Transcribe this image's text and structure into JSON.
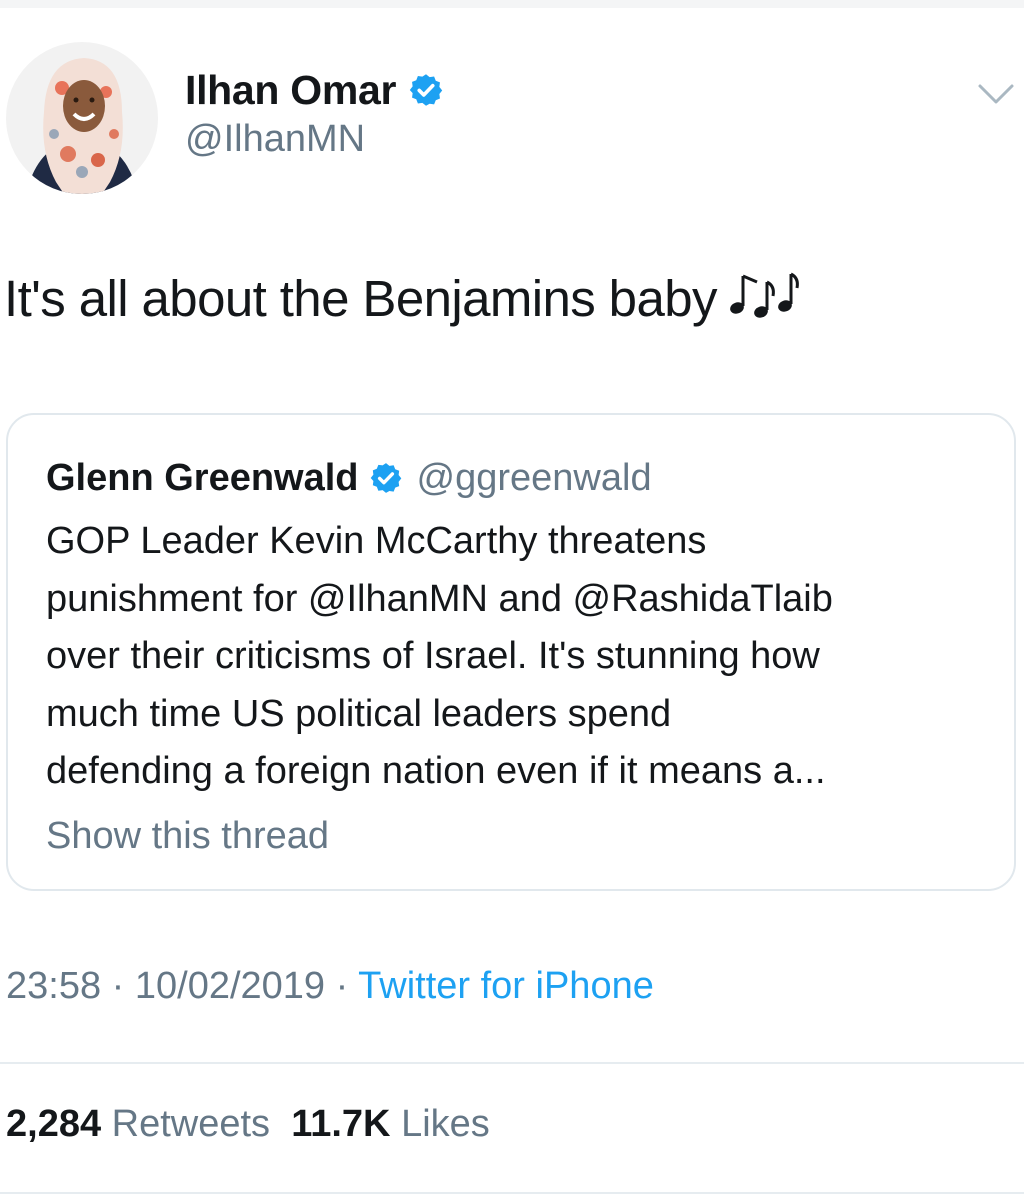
{
  "tweet": {
    "author": {
      "name": "Ilhan Omar",
      "handle": "@IlhanMN",
      "avatar_icon": "profile-photo",
      "verified": true
    },
    "menu_icon": "chevron-down-icon",
    "text": "It's all about the Benjamins baby",
    "emoji": "music-notes-icon",
    "quoted_tweet": {
      "author_name": "Glenn Greenwald",
      "author_handle": "@ggreenwald",
      "verified": true,
      "body_lines": [
        "GOP Leader Kevin McCarthy threatens",
        "punishment for @IlhanMN and @RashidaTlaib",
        "over their criticisms of Israel. It's stunning how",
        "much time US political leaders spend",
        "defending a foreign nation even if it means a..."
      ],
      "show_thread_label": "Show this thread"
    },
    "meta": {
      "time": "23:58",
      "separator": "·",
      "date": "10/02/2019",
      "source": "Twitter for iPhone"
    },
    "stats": {
      "retweets_count": "2,284",
      "retweets_label": "Retweets",
      "likes_count": "11.7K",
      "likes_label": "Likes"
    }
  },
  "colors": {
    "verified_blue": "#1da1f2",
    "secondary_text": "#657786",
    "primary_text": "#14171a",
    "border": "#e1e8ed"
  }
}
